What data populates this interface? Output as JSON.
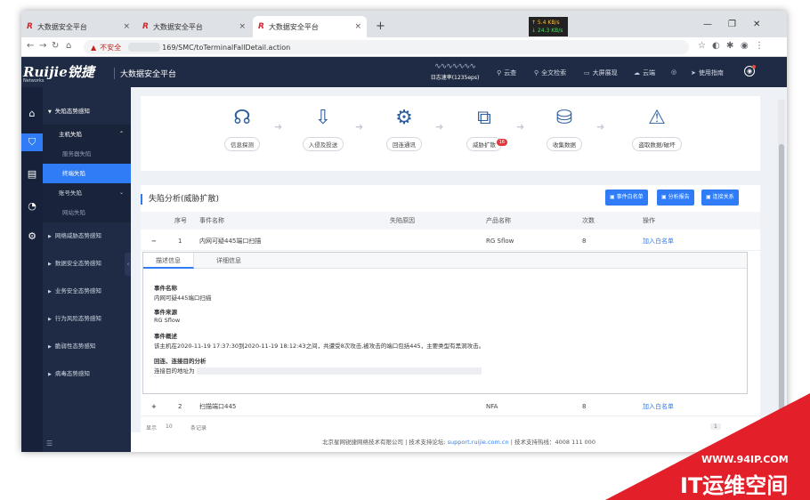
{
  "browser": {
    "tabs": [
      {
        "favicon": "R",
        "title": "大数据安全平台"
      },
      {
        "favicon": "R",
        "title": "大数据安全平台"
      },
      {
        "favicon": "R",
        "title": "大数据安全平台"
      }
    ],
    "tab_close": "×",
    "new_tab": "+",
    "net_speed": {
      "up": "↑ 5.4 KB/s",
      "down": "↓ 24.3 KB/s"
    },
    "window_controls": {
      "minimize": "—",
      "maximize": "❐",
      "close": "✕"
    },
    "address": {
      "warning": "▲",
      "insecure_label": "不安全",
      "url_visible": "169/SMC/toTerminalFallDetail.action"
    }
  },
  "header": {
    "logo": "Ruijie锐捷",
    "logo_sub": "Networks",
    "app_title": "大数据安全平台",
    "log_rate": "日志速率(1235eps)",
    "nav": [
      {
        "icon": "search-icon",
        "glyph": "⚲",
        "label": "云查"
      },
      {
        "icon": "fulltext-search-icon",
        "glyph": "⚲",
        "label": "全文检索"
      },
      {
        "icon": "monitor-icon",
        "glyph": "▭",
        "label": "大屏展现"
      },
      {
        "icon": "cloud-icon",
        "glyph": "☁",
        "label": "云端"
      },
      {
        "icon": "headset-icon",
        "glyph": "◎",
        "label": ""
      },
      {
        "icon": "send-icon",
        "glyph": "➤",
        "label": "使用指南"
      }
    ],
    "user_glyph": "◉"
  },
  "rail": [
    {
      "icon": "home-icon",
      "glyph": "⌂"
    },
    {
      "icon": "shield-icon",
      "glyph": "⛉"
    },
    {
      "icon": "clipboard-icon",
      "glyph": "▤"
    },
    {
      "icon": "pie-chart-icon",
      "glyph": "◔"
    },
    {
      "icon": "gear-icon",
      "glyph": "⚙"
    }
  ],
  "sidebar": {
    "group_title": "失陷态势感知",
    "host_fall": "主机失陷",
    "server_fall": "服务器失陷",
    "terminal_fall": "终端失陷",
    "account_fall": "账号失陷",
    "website_fall": "网站失陷",
    "items": [
      "网络威胁态势感知",
      "数据安全态势感知",
      "业务安全态势感知",
      "行为风险态势感知",
      "脆弱性态势感知",
      "病毒态势感知"
    ],
    "collapse": "‹",
    "bottom": "☰"
  },
  "flow": {
    "steps": [
      {
        "icon": "probe-icon",
        "glyph": "☊",
        "label": "信息探测"
      },
      {
        "icon": "intrusion-icon",
        "glyph": "⇩",
        "label": "入侵及投送"
      },
      {
        "icon": "callback-icon",
        "glyph": "⚙",
        "label": "回连通讯"
      },
      {
        "icon": "spread-icon",
        "glyph": "⧉",
        "label": "威胁扩散",
        "badge": "16"
      },
      {
        "icon": "collect-icon",
        "glyph": "⛁",
        "label": "收集数据"
      },
      {
        "icon": "steal-icon",
        "glyph": "⚠",
        "label": "盗取数据/破坏"
      }
    ],
    "arrow": "➜"
  },
  "panel": {
    "title": "失陷分析(威胁扩散)",
    "buttons": {
      "whitelist": "事件白名单",
      "report": "分析报告",
      "relation": "连接关系"
    },
    "columns": {
      "index": "序号",
      "name": "事件名称",
      "reason": "失陷原因",
      "product": "产品名称",
      "count": "次数",
      "action": "操作"
    },
    "rows": [
      {
        "toggle": "−",
        "index": "1",
        "name": "内网可疑445端口扫描",
        "reason": "",
        "product": "RG Sflow",
        "count": "8",
        "action": "加入白名单"
      },
      {
        "toggle": "+",
        "index": "2",
        "name": "扫描端口445",
        "reason": "",
        "product": "NFA",
        "count": "8",
        "action": "加入白名单"
      }
    ],
    "detail": {
      "tabs": [
        "描述信息",
        "详细信息"
      ],
      "event_name_label": "事件名称",
      "event_name": "内网可疑445端口扫描",
      "source_label": "事件来源",
      "source": "RG Sflow",
      "overview_label": "事件概述",
      "overview": "该主机在2020-11-19 17:37:30到2020-11-19 18:12:43之间，共遭受8次攻击,被攻击的端口包括445，主要类型有黑洞攻击。",
      "callback_label": "回连、连接目的分析",
      "callback": "连接目的地址为"
    },
    "pager": {
      "show": "显示",
      "size": "10",
      "records": "条记录",
      "page": "1"
    }
  },
  "footer": {
    "company": "北京星网锐捷网络技术有限公司",
    "sep1": "|",
    "support_label": "技术支持论坛:",
    "support_link": "support.ruijie.com.cn",
    "sep2": "|",
    "hotline": "技术支持热线：4008 111 000"
  },
  "watermark": {
    "site": "WWW.94IP.COM",
    "brand": "IT运维空间"
  }
}
